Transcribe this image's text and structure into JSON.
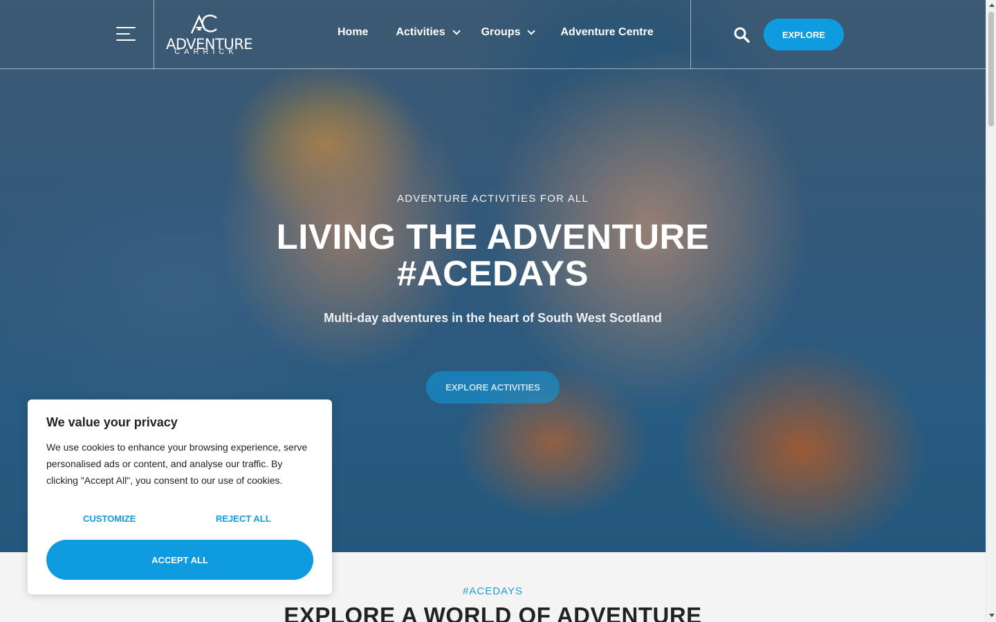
{
  "header": {
    "logo_main": "ADVENTURE",
    "logo_sub": "CARRICK",
    "nav": [
      {
        "label": "Home",
        "has_dropdown": false
      },
      {
        "label": "Activities",
        "has_dropdown": true
      },
      {
        "label": "Groups",
        "has_dropdown": true
      },
      {
        "label": "Adventure Centre",
        "has_dropdown": false
      }
    ],
    "explore_label": "EXPLORE"
  },
  "hero": {
    "eyebrow": "ADVENTURE ACTIVITIES FOR ALL",
    "title_line1": "LIVING THE ADVENTURE",
    "title_line2": "#ACEDAYS",
    "subtitle": "Multi-day adventures in the heart of South West Scotland",
    "button_label": "EXPLORE ACTIVITIES"
  },
  "section": {
    "tag": "#ACEDAYS",
    "title": "EXPLORE A WORLD OF ADVENTURE"
  },
  "cookie": {
    "title": "We value your privacy",
    "body": "We use cookies to enhance your browsing experience, serve personalised ads or content, and analyse our traffic. By clicking \"Accept All\", you consent to our use of cookies.",
    "customize_label": "CUSTOMIZE",
    "reject_label": "REJECT ALL",
    "accept_label": "ACCEPT ALL"
  },
  "colors": {
    "accent": "#0e9be0",
    "tag": "#1d9bd6"
  }
}
